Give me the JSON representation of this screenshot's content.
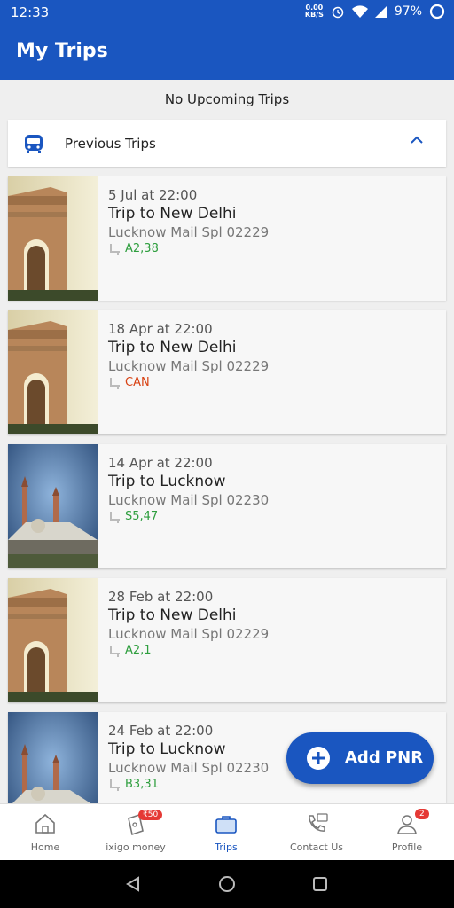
{
  "status_bar": {
    "time": "12:33",
    "net_speed": "0.00",
    "net_unit": "KB/S",
    "battery": "97%"
  },
  "app_bar": {
    "title": "My Trips"
  },
  "upcoming": {
    "message": "No Upcoming Trips"
  },
  "previous": {
    "label": "Previous Trips"
  },
  "trips": [
    {
      "date": "5 Jul at 22:00",
      "title": "Trip to New Delhi",
      "train": "Lucknow Mail Spl  02229",
      "seat": "A2,38",
      "seat_color": "#2e9e3e",
      "image": "india-gate"
    },
    {
      "date": "18 Apr at 22:00",
      "title": "Trip to New Delhi",
      "train": "Lucknow Mail Spl  02229",
      "seat": "CAN",
      "seat_color": "#d84315",
      "image": "india-gate"
    },
    {
      "date": "14 Apr at 22:00",
      "title": "Trip to Lucknow",
      "train": "Lucknow Mail Spl  02230",
      "seat": "S5,47",
      "seat_color": "#2e9e3e",
      "image": "lucknow-monument"
    },
    {
      "date": "28 Feb at 22:00",
      "title": "Trip to New Delhi",
      "train": "Lucknow Mail Spl  02229",
      "seat": "A2,1",
      "seat_color": "#2e9e3e",
      "image": "india-gate"
    },
    {
      "date": "24 Feb at 22:00",
      "title": "Trip to Lucknow",
      "train": "Lucknow Mail Spl  02230",
      "seat": "B3,31",
      "seat_color": "#2e9e3e",
      "image": "lucknow-monument"
    }
  ],
  "fab": {
    "label": "Add PNR"
  },
  "bottom_nav": [
    {
      "label": "Home",
      "icon": "home-icon"
    },
    {
      "label": "ixigo money",
      "icon": "wallet-icon",
      "badge": "₹50"
    },
    {
      "label": "Trips",
      "icon": "suitcase-icon",
      "active": true
    },
    {
      "label": "Contact Us",
      "icon": "phone-icon"
    },
    {
      "label": "Profile",
      "icon": "user-icon",
      "badge": "2"
    }
  ],
  "colors": {
    "primary": "#1a56c0",
    "confirmed": "#2e9e3e",
    "cancelled": "#d84315"
  }
}
